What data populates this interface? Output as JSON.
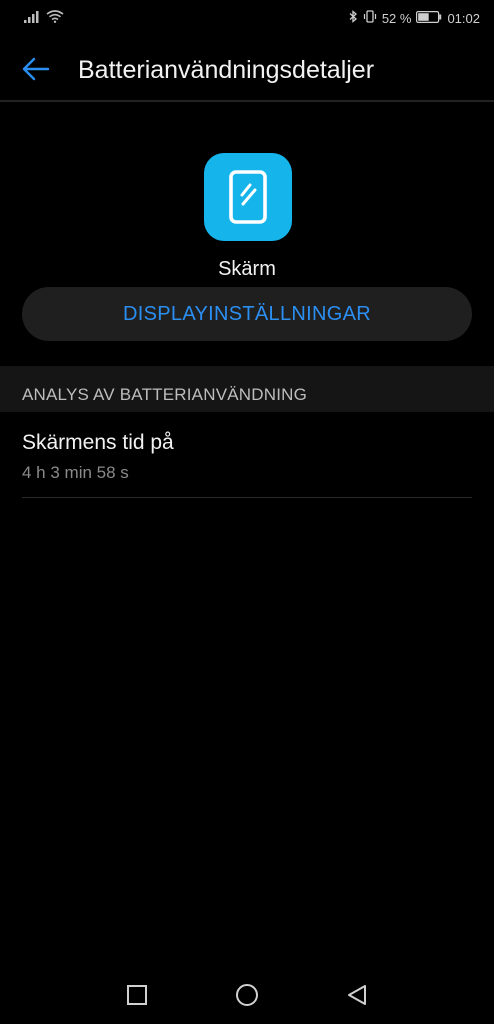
{
  "status_bar": {
    "battery_percent": "52 %",
    "time": "01:02",
    "icons": [
      "signal-icon",
      "wifi-icon",
      "bluetooth-icon",
      "vibrate-icon",
      "battery-icon"
    ]
  },
  "header": {
    "title": "Batterianvändningsdetaljer"
  },
  "app": {
    "name": "Skärm",
    "icon_color": "#15b5ec"
  },
  "display_settings_button": "DISPLAYINSTÄLLNINGAR",
  "analysis": {
    "section_title": "ANALYS AV BATTERIANVÄNDNING",
    "items": [
      {
        "title": "Skärmens tid på",
        "value": "4 h 3 min 58 s"
      }
    ]
  },
  "colors": {
    "accent": "#2b8ff2",
    "background": "#000000"
  }
}
